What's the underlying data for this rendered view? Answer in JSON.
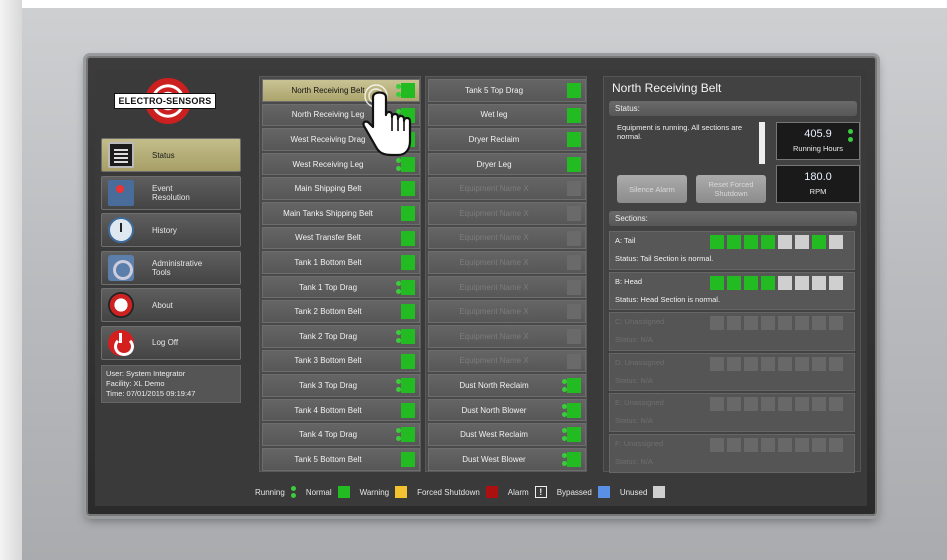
{
  "logo_text": "ELECTRO-SENSORS",
  "nav": [
    {
      "label": "Status",
      "icon": "status-icon",
      "active": true
    },
    {
      "label": "Event\nResolution",
      "icon": "event-icon",
      "active": false
    },
    {
      "label": "History",
      "icon": "history-icon",
      "active": false
    },
    {
      "label": "Administrative\nTools",
      "icon": "admin-tools-icon",
      "active": false
    },
    {
      "label": "About",
      "icon": "about-icon",
      "active": false
    },
    {
      "label": "Log Off",
      "icon": "log-off-icon",
      "active": false
    }
  ],
  "user_info": {
    "user": "User: System Integrator",
    "facility": "Facility: XL Demo",
    "time": "Time: 07/01/2015 09:19:47"
  },
  "equipment_col1": [
    {
      "name": "North Receiving Belt",
      "running": true,
      "state": "normal",
      "selected": true
    },
    {
      "name": "North Receiving Leg",
      "running": true,
      "state": "normal"
    },
    {
      "name": "West Receiving Drag",
      "running": true,
      "state": "normal"
    },
    {
      "name": "West Receiving Leg",
      "running": true,
      "state": "normal"
    },
    {
      "name": "Main Shipping Belt",
      "running": false,
      "state": "normal"
    },
    {
      "name": "Main Tanks Shipping Belt",
      "running": false,
      "state": "normal"
    },
    {
      "name": "West Transfer Belt",
      "running": false,
      "state": "normal"
    },
    {
      "name": "Tank 1 Bottom Belt",
      "running": false,
      "state": "normal"
    },
    {
      "name": "Tank 1 Top Drag",
      "running": true,
      "state": "normal"
    },
    {
      "name": "Tank 2 Bottom Belt",
      "running": false,
      "state": "normal"
    },
    {
      "name": "Tank 2 Top Drag",
      "running": true,
      "state": "normal"
    },
    {
      "name": "Tank 3 Bottom Belt",
      "running": false,
      "state": "normal"
    },
    {
      "name": "Tank 3 Top Drag",
      "running": true,
      "state": "normal"
    },
    {
      "name": "Tank 4 Bottom Belt",
      "running": false,
      "state": "normal"
    },
    {
      "name": "Tank 4 Top Drag",
      "running": true,
      "state": "normal"
    },
    {
      "name": "Tank 5 Bottom Belt",
      "running": false,
      "state": "normal"
    }
  ],
  "equipment_col2": [
    {
      "name": "Tank 5 Top Drag",
      "running": false,
      "state": "normal"
    },
    {
      "name": "Wet leg",
      "running": false,
      "state": "normal"
    },
    {
      "name": "Dryer Reclaim",
      "running": false,
      "state": "normal"
    },
    {
      "name": "Dryer Leg",
      "running": false,
      "state": "normal"
    },
    {
      "name": "Equipment Name X",
      "running": false,
      "state": "unassigned"
    },
    {
      "name": "Equipment Name X",
      "running": false,
      "state": "unassigned"
    },
    {
      "name": "Equipment Name X",
      "running": false,
      "state": "unassigned"
    },
    {
      "name": "Equipment Name X",
      "running": false,
      "state": "unassigned"
    },
    {
      "name": "Equipment Name X",
      "running": false,
      "state": "unassigned"
    },
    {
      "name": "Equipment Name X",
      "running": false,
      "state": "unassigned"
    },
    {
      "name": "Equipment Name X",
      "running": false,
      "state": "unassigned"
    },
    {
      "name": "Equipment Name X",
      "running": false,
      "state": "unassigned"
    },
    {
      "name": "Dust North Reclaim",
      "running": true,
      "state": "normal"
    },
    {
      "name": "Dust North Blower",
      "running": true,
      "state": "normal"
    },
    {
      "name": "Dust West Reclaim",
      "running": true,
      "state": "normal"
    },
    {
      "name": "Dust West Blower",
      "running": true,
      "state": "normal"
    }
  ],
  "detail": {
    "title": "North Receiving Belt",
    "status_header": "Status:",
    "status_text": "Equipment is running. All sections are normal.",
    "running_hours_value": "405.9",
    "running_hours_label": "Running Hours",
    "rpm_value": "180.0",
    "rpm_label": "RPM",
    "silence_alarm": "Silence Alarm",
    "reset_forced_shutdown": "Reset Forced\nShutdown",
    "sections_header": "Sections:",
    "sections": [
      {
        "name": "A: Tail",
        "status": "Status: Tail Section is normal.",
        "assigned": true,
        "bays": [
          "g",
          "g",
          "g",
          "g",
          "w",
          "w",
          "g",
          "w"
        ]
      },
      {
        "name": "B: Head",
        "status": "Status: Head Section is normal.",
        "assigned": true,
        "bays": [
          "g",
          "g",
          "g",
          "g",
          "w",
          "w",
          "w",
          "w"
        ]
      },
      {
        "name": "C: Unassigned",
        "status": "Status: N/A",
        "assigned": false,
        "bays": [
          "d",
          "d",
          "d",
          "d",
          "d",
          "d",
          "d",
          "d"
        ]
      },
      {
        "name": "D: Unassigned",
        "status": "Status: N/A",
        "assigned": false,
        "bays": [
          "d",
          "d",
          "d",
          "d",
          "d",
          "d",
          "d",
          "d"
        ]
      },
      {
        "name": "E: Unassigned",
        "status": "Status: N/A",
        "assigned": false,
        "bays": [
          "d",
          "d",
          "d",
          "d",
          "d",
          "d",
          "d",
          "d"
        ]
      },
      {
        "name": "F: Unassigned",
        "status": "Status: N/A",
        "assigned": false,
        "bays": [
          "d",
          "d",
          "d",
          "d",
          "d",
          "d",
          "d",
          "d"
        ]
      }
    ]
  },
  "legend": {
    "running": "Running",
    "normal": "Normal",
    "warning": "Warning",
    "forced_shutdown": "Forced Shutdown",
    "alarm": "Alarm",
    "alarm_symbol": "!",
    "bypassed": "Bypassed",
    "unused": "Unused"
  },
  "colors": {
    "normal": "#22bb22",
    "warning": "#f2c230",
    "forced_shutdown": "#aa1010",
    "bypassed": "#5a8fe6",
    "unused": "#cfcfcf",
    "selected_row": "#c9c394"
  }
}
